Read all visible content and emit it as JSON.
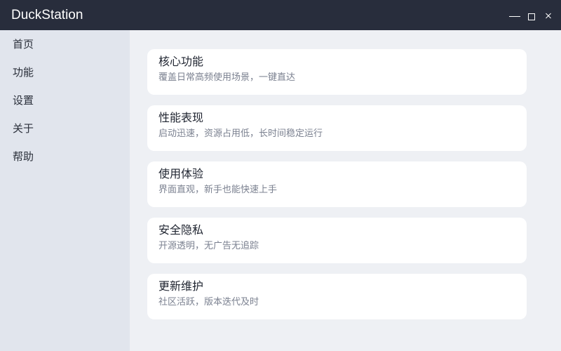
{
  "window": {
    "title": "DuckStation"
  },
  "sidebar": {
    "items": [
      {
        "label": "首页"
      },
      {
        "label": "功能"
      },
      {
        "label": "设置"
      },
      {
        "label": "关于"
      },
      {
        "label": "帮助"
      }
    ]
  },
  "main": {
    "cards": [
      {
        "title": "核心功能",
        "desc": "覆盖日常高频使用场景，一键直达"
      },
      {
        "title": "性能表现",
        "desc": "启动迅速，资源占用低，长时间稳定运行"
      },
      {
        "title": "使用体验",
        "desc": "界面直观，新手也能快速上手"
      },
      {
        "title": "安全隐私",
        "desc": "开源透明，无广告无追踪"
      },
      {
        "title": "更新维护",
        "desc": "社区活跃，版本迭代及时"
      }
    ]
  },
  "icons": {
    "minimize": "minimize-icon",
    "maximize": "maximize-icon",
    "close": "close-icon"
  },
  "colors": {
    "titlebar": "#282d3c",
    "sidebar": "#e1e5ed",
    "content": "#eef0f4",
    "card": "#ffffff"
  }
}
